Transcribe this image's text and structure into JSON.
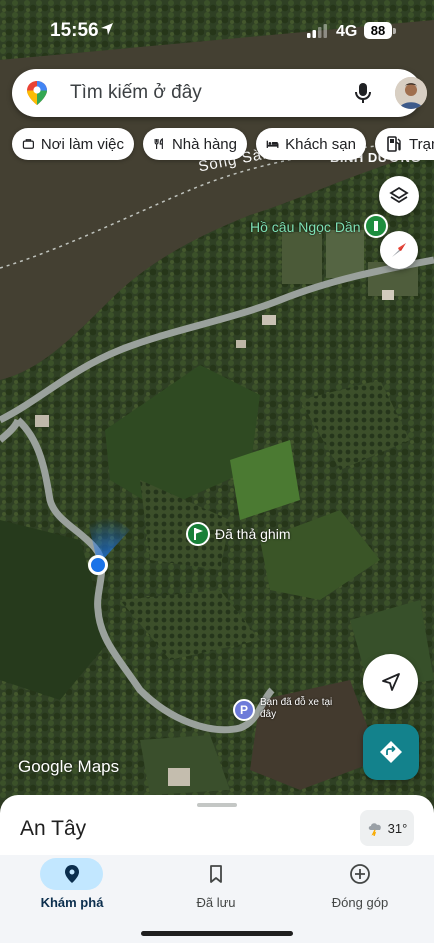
{
  "status_bar": {
    "time": "15:56",
    "network": "4G",
    "battery": "88"
  },
  "search": {
    "placeholder": "Tìm kiếm ở đây"
  },
  "chips": [
    {
      "label": "Nơi làm việc",
      "icon": "briefcase-icon"
    },
    {
      "label": "Nhà hàng",
      "icon": "fork-knife-icon"
    },
    {
      "label": "Khách sạn",
      "icon": "bed-icon"
    },
    {
      "label": "Trạm",
      "icon": "gas-station-icon"
    }
  ],
  "map": {
    "labels": {
      "river": "Sông Sài",
      "province": "BÌNH DƯƠNG",
      "poi": "Hồ câu Ngọc Dần",
      "pin": "Đã thả ghim",
      "parking": "Bạn đã đỗ xe tại đây"
    },
    "attribution": "Google Maps"
  },
  "bottom_sheet": {
    "place": "An Tây",
    "weather": "31°"
  },
  "nav": {
    "explore": "Khám phá",
    "saved": "Đã lưu",
    "contribute": "Đóng góp"
  },
  "colors": {
    "accent": "#13828c",
    "pill": "#c2e7ff",
    "location": "#1a73e8"
  }
}
